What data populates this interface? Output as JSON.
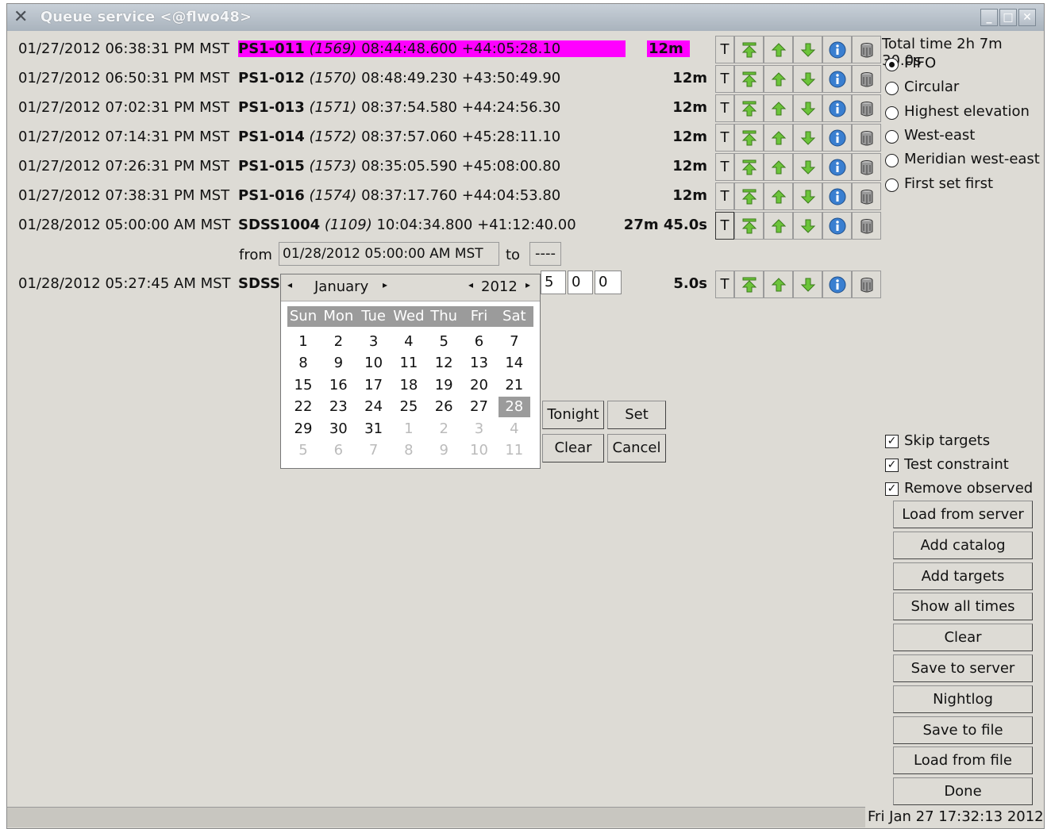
{
  "window": {
    "title": "Queue service <@flwo48>",
    "buttons": [
      "_",
      "□",
      "✕"
    ]
  },
  "rows": [
    {
      "date": "01/27/2012 06:38:31 PM MST",
      "name": "PS1-011",
      "id": "(1569)",
      "coords": "08:44:48.600 +44:05:28.10",
      "duration": "12m",
      "highlight": true
    },
    {
      "date": "01/27/2012 06:50:31 PM MST",
      "name": "PS1-012",
      "id": "(1570)",
      "coords": "08:48:49.230 +43:50:49.90",
      "duration": "12m",
      "highlight": false
    },
    {
      "date": "01/27/2012 07:02:31 PM MST",
      "name": "PS1-013",
      "id": "(1571)",
      "coords": "08:37:54.580 +44:24:56.30",
      "duration": "12m",
      "highlight": false
    },
    {
      "date": "01/27/2012 07:14:31 PM MST",
      "name": "PS1-014",
      "id": "(1572)",
      "coords": "08:37:57.060 +45:28:11.10",
      "duration": "12m",
      "highlight": false
    },
    {
      "date": "01/27/2012 07:26:31 PM MST",
      "name": "PS1-015",
      "id": "(1573)",
      "coords": "08:35:05.590 +45:08:00.80",
      "duration": "12m",
      "highlight": false
    },
    {
      "date": "01/27/2012 07:38:31 PM MST",
      "name": "PS1-016",
      "id": "(1574)",
      "coords": "08:37:17.760 +44:04:53.80",
      "duration": "12m",
      "highlight": false
    },
    {
      "date": "01/28/2012 05:00:00 AM MST",
      "name": "SDSS1004",
      "id": "(1109)",
      "coords": "10:04:34.800 +41:12:40.00",
      "duration": "27m 45.0s",
      "highlight": false
    },
    {
      "date": "01/28/2012 05:27:45 AM MST",
      "name": "SDSS1",
      "id": "",
      "coords": "",
      "duration": "5.0s",
      "highlight": false
    }
  ],
  "row_button_t": "T",
  "row_icons": [
    "top-icon",
    "up-icon",
    "down-icon",
    "info-icon",
    "trash-icon"
  ],
  "time_edit": {
    "from_label": "from",
    "from_value": "01/28/2012 05:00:00 AM MST",
    "to_label": "to",
    "to_value": "----",
    "fields": [
      "5",
      "0",
      "0"
    ]
  },
  "calendar": {
    "month": "January",
    "year": "2012",
    "weekdays": [
      "Sun",
      "Mon",
      "Tue",
      "Wed",
      "Thu",
      "Fri",
      "Sat"
    ],
    "weeks": [
      [
        "1",
        "2",
        "3",
        "4",
        "5",
        "6",
        "7"
      ],
      [
        "8",
        "9",
        "10",
        "11",
        "12",
        "13",
        "14"
      ],
      [
        "15",
        "16",
        "17",
        "18",
        "19",
        "20",
        "21"
      ],
      [
        "22",
        "23",
        "24",
        "25",
        "26",
        "27",
        "28"
      ],
      [
        "29",
        "30",
        "31",
        "1",
        "2",
        "3",
        "4"
      ],
      [
        "5",
        "6",
        "7",
        "8",
        "9",
        "10",
        "11"
      ]
    ],
    "selected": "28",
    "tonight": "Tonight",
    "set": "Set",
    "clear": "Clear",
    "cancel": "Cancel"
  },
  "sidebar": {
    "total": "Total time 2h 7m 30.0s",
    "radios": [
      {
        "label": "FIFO",
        "checked": true
      },
      {
        "label": "Circular",
        "checked": false
      },
      {
        "label": "Highest elevation",
        "checked": false
      },
      {
        "label": "West-east",
        "checked": false
      },
      {
        "label": "Meridian west-east",
        "checked": false
      },
      {
        "label": "First set first",
        "checked": false
      }
    ],
    "checks": [
      {
        "label": "Skip targets",
        "checked": true
      },
      {
        "label": "Test constraint",
        "checked": true
      },
      {
        "label": "Remove observed",
        "checked": true
      }
    ],
    "buttons": [
      "Load from server",
      "Add catalog",
      "Add targets",
      "Show all times",
      "Clear",
      "Save to server",
      "Nightlog",
      "Save to file",
      "Load from file",
      "Done"
    ]
  },
  "status": {
    "clock": "Fri Jan 27 17:32:13 2012"
  },
  "colors": {
    "highlight": "#ff00ff",
    "icon_green": "#6cc43a",
    "icon_blue": "#3a7fd0"
  }
}
